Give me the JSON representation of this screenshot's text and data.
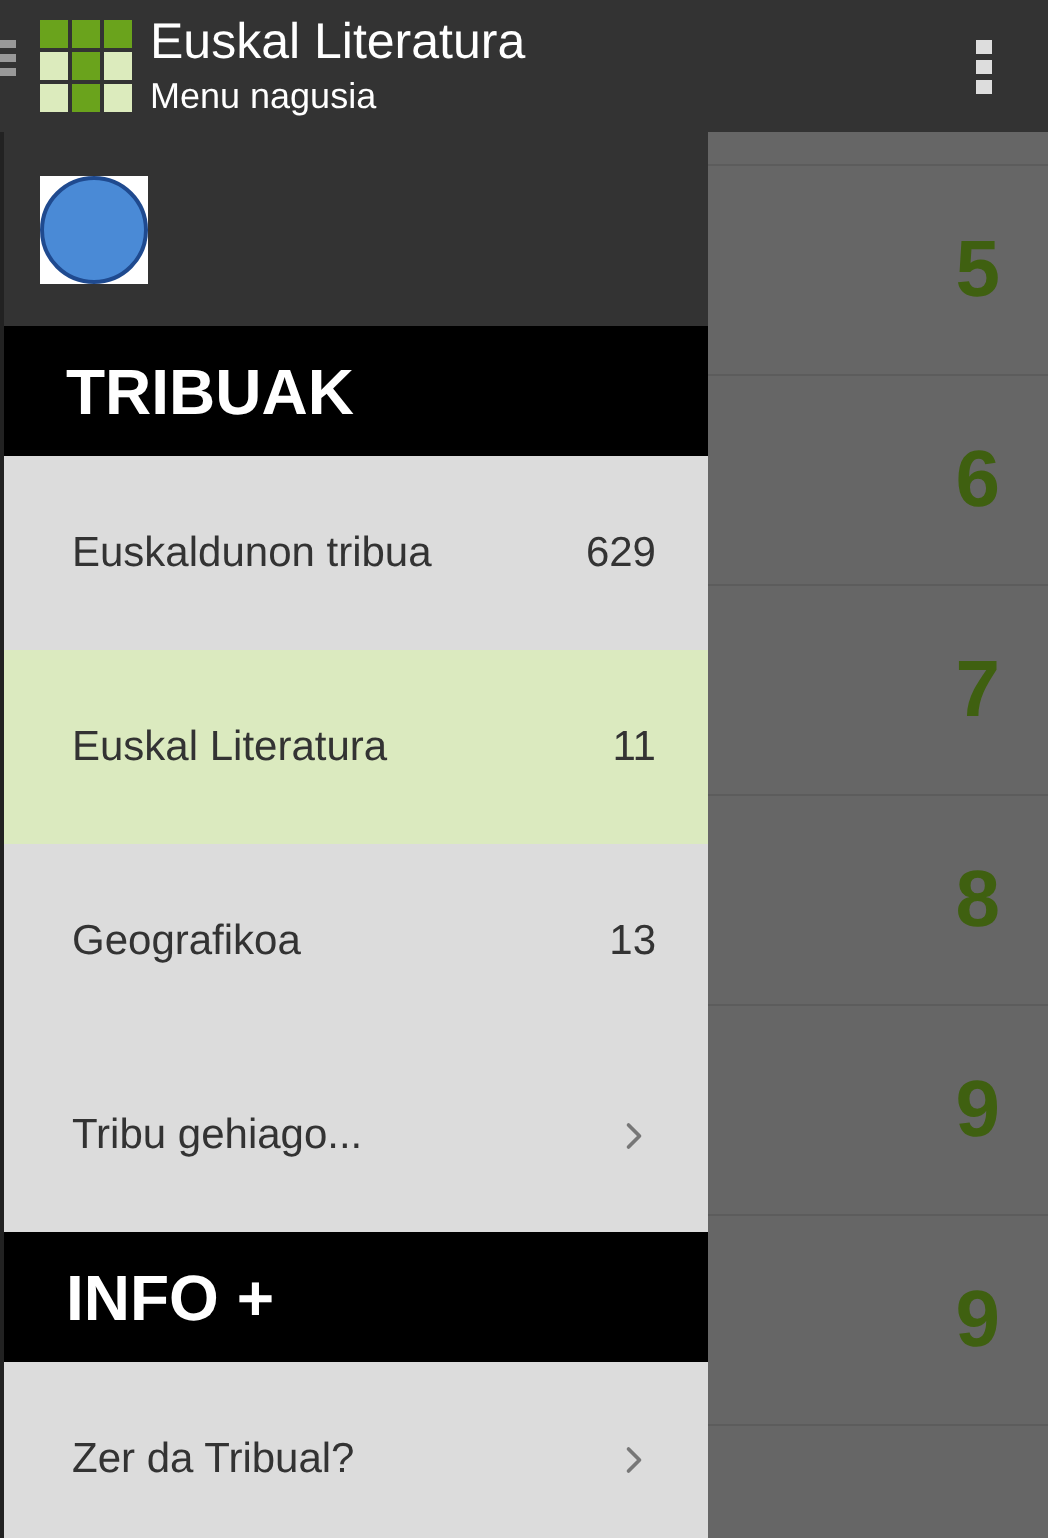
{
  "app_bar": {
    "title": "Euskal Literatura",
    "subtitle": "Menu nagusia"
  },
  "drawer": {
    "sections": [
      {
        "title": "TRIBUAK",
        "items": [
          {
            "kind": "count",
            "label": "Euskaldunon tribua",
            "count": "629",
            "selected": false
          },
          {
            "kind": "count",
            "label": "Euskal Literatura",
            "count": "11",
            "selected": true
          },
          {
            "kind": "count",
            "label": "Geografikoa",
            "count": "13",
            "selected": false
          },
          {
            "kind": "link",
            "label": "Tribu gehiago...",
            "selected": false
          }
        ]
      },
      {
        "title": "INFO +",
        "items": [
          {
            "kind": "link",
            "label": "Zer da Tribual?",
            "selected": false
          }
        ]
      }
    ]
  },
  "list": {
    "rows": [
      "5",
      "6",
      "7",
      "8",
      "9",
      "9"
    ]
  }
}
